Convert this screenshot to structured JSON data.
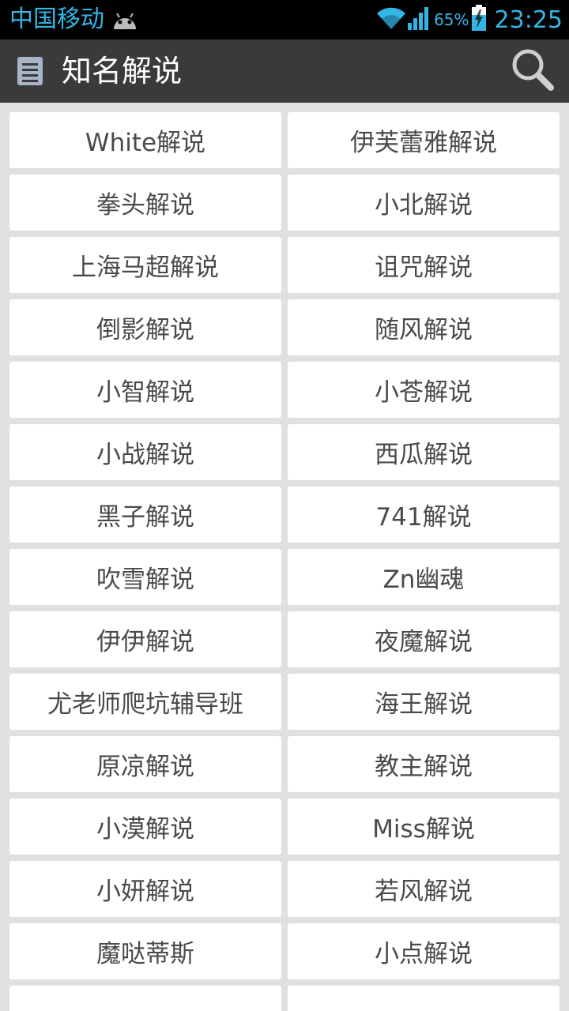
{
  "status_bar": {
    "carrier": "中国移动",
    "battery_percent": "65%",
    "time": "23:25",
    "accent_color": "#33b5e5",
    "icons": [
      "android-icon",
      "wifi-icon",
      "signal-icon",
      "battery-charging-icon"
    ]
  },
  "action_bar": {
    "title": "知名解说",
    "icons": [
      "list-icon",
      "search-icon"
    ]
  },
  "grid": {
    "items": [
      "White解说",
      "伊芙蕾雅解说",
      "拳头解说",
      "小北解说",
      "上海马超解说",
      "诅咒解说",
      "倒影解说",
      "随风解说",
      "小智解说",
      "小苍解说",
      "小战解说",
      "西瓜解说",
      "黑子解说",
      "741解说",
      "吹雪解说",
      "Zn幽魂",
      "伊伊解说",
      "夜魔解说",
      "尤老师爬坑辅导班",
      "海王解说",
      "原凉解说",
      "教主解说",
      "小漠解说",
      "Miss解说",
      "小妍解说",
      "若风解说",
      "魔哒蒂斯",
      "小点解说",
      "",
      ""
    ]
  }
}
